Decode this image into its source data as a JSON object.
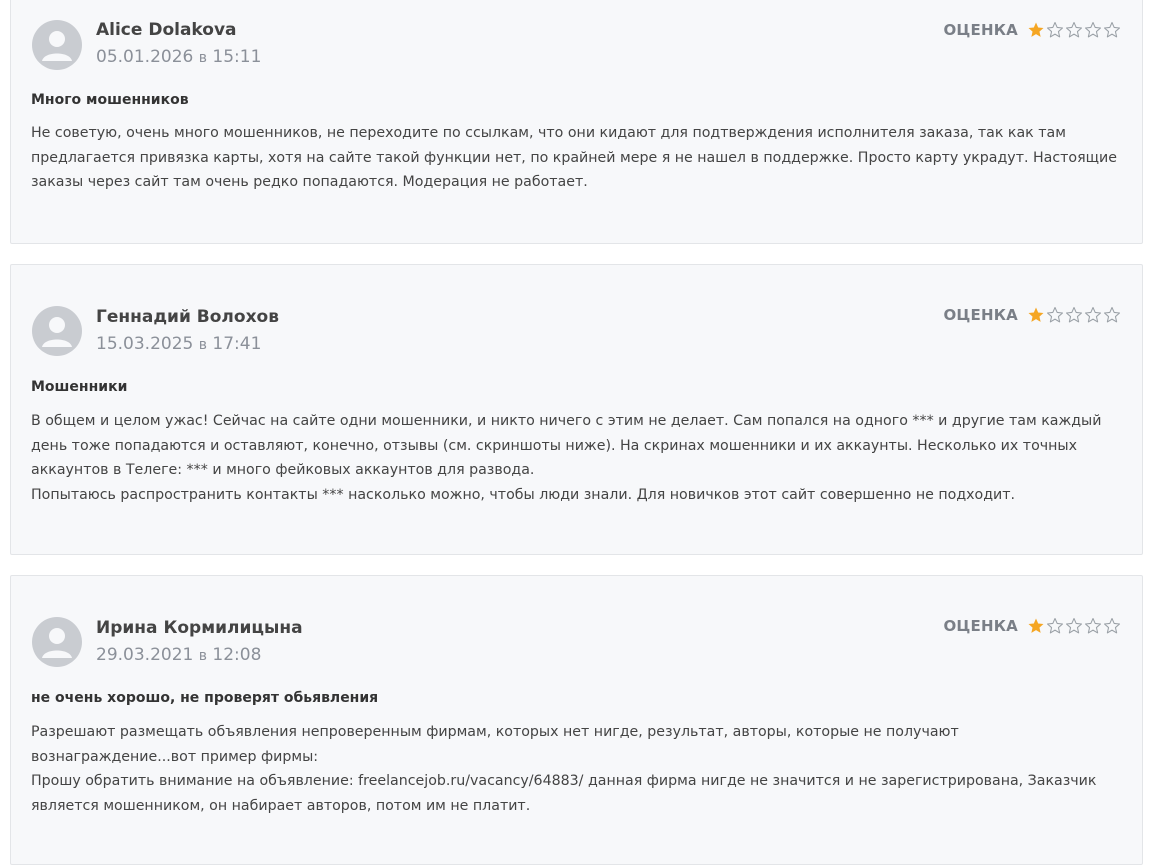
{
  "rating_label": "ОЦЕНКА",
  "colors": {
    "star_filled": "#f5a623",
    "star_empty": "#9aa0a6",
    "card_bg": "#f7f8fa"
  },
  "reviews": [
    {
      "author": "Alice Dolakova",
      "date": "05.01.2026",
      "at": "в",
      "time": "15:11",
      "rating": 1,
      "title": "Много мошенников",
      "paragraphs": [
        "Не советую, очень много мошенников, не переходите по ссылкам, что они кидают для подтверждения исполнителя заказа, так как там предлагается привязка карты, хотя на сайте такой функции нет, по крайней мере я не нашел в поддержке. Просто карту украдут. Настоящие заказы через сайт там очень редко попадаются. Модерация не работает."
      ]
    },
    {
      "author": "Геннадий Волохов",
      "date": "15.03.2025",
      "at": "в",
      "time": "17:41",
      "rating": 1,
      "title": "Мошенники",
      "paragraphs": [
        "В общем и целом ужас! Сейчас на сайте одни мошенники, и никто ничего с этим не делает. Сам попался на одного *** и другие там каждый день тоже попадаются и оставляют, конечно, отзывы (см. скриншоты ниже). На скринах мошенники и их аккаунты. Несколько их точных аккаунтов в Телеге: *** и много фейковых аккаунтов для развода.",
        "Попытаюсь распространить контакты *** насколько можно, чтобы люди знали. Для новичков этот сайт совершенно не подходит."
      ]
    },
    {
      "author": "Ирина Кормилицына",
      "date": "29.03.2021",
      "at": "в",
      "time": "12:08",
      "rating": 1,
      "title": "не очень хорошо, не проверят обьявления",
      "paragraphs": [
        "Разрешают размещать объявления непроверенным фирмам, которых нет нигде, результат, авторы, которые не получают вознаграждение...вот пример фирмы:",
        "Прошу обратить внимание на объявление: freelancejob.ru/vacancy/64883/ данная фирма нигде не значится и не зарегистрирована, Заказчик является мошенником, он набирает авторов, потом им не платит."
      ]
    }
  ]
}
